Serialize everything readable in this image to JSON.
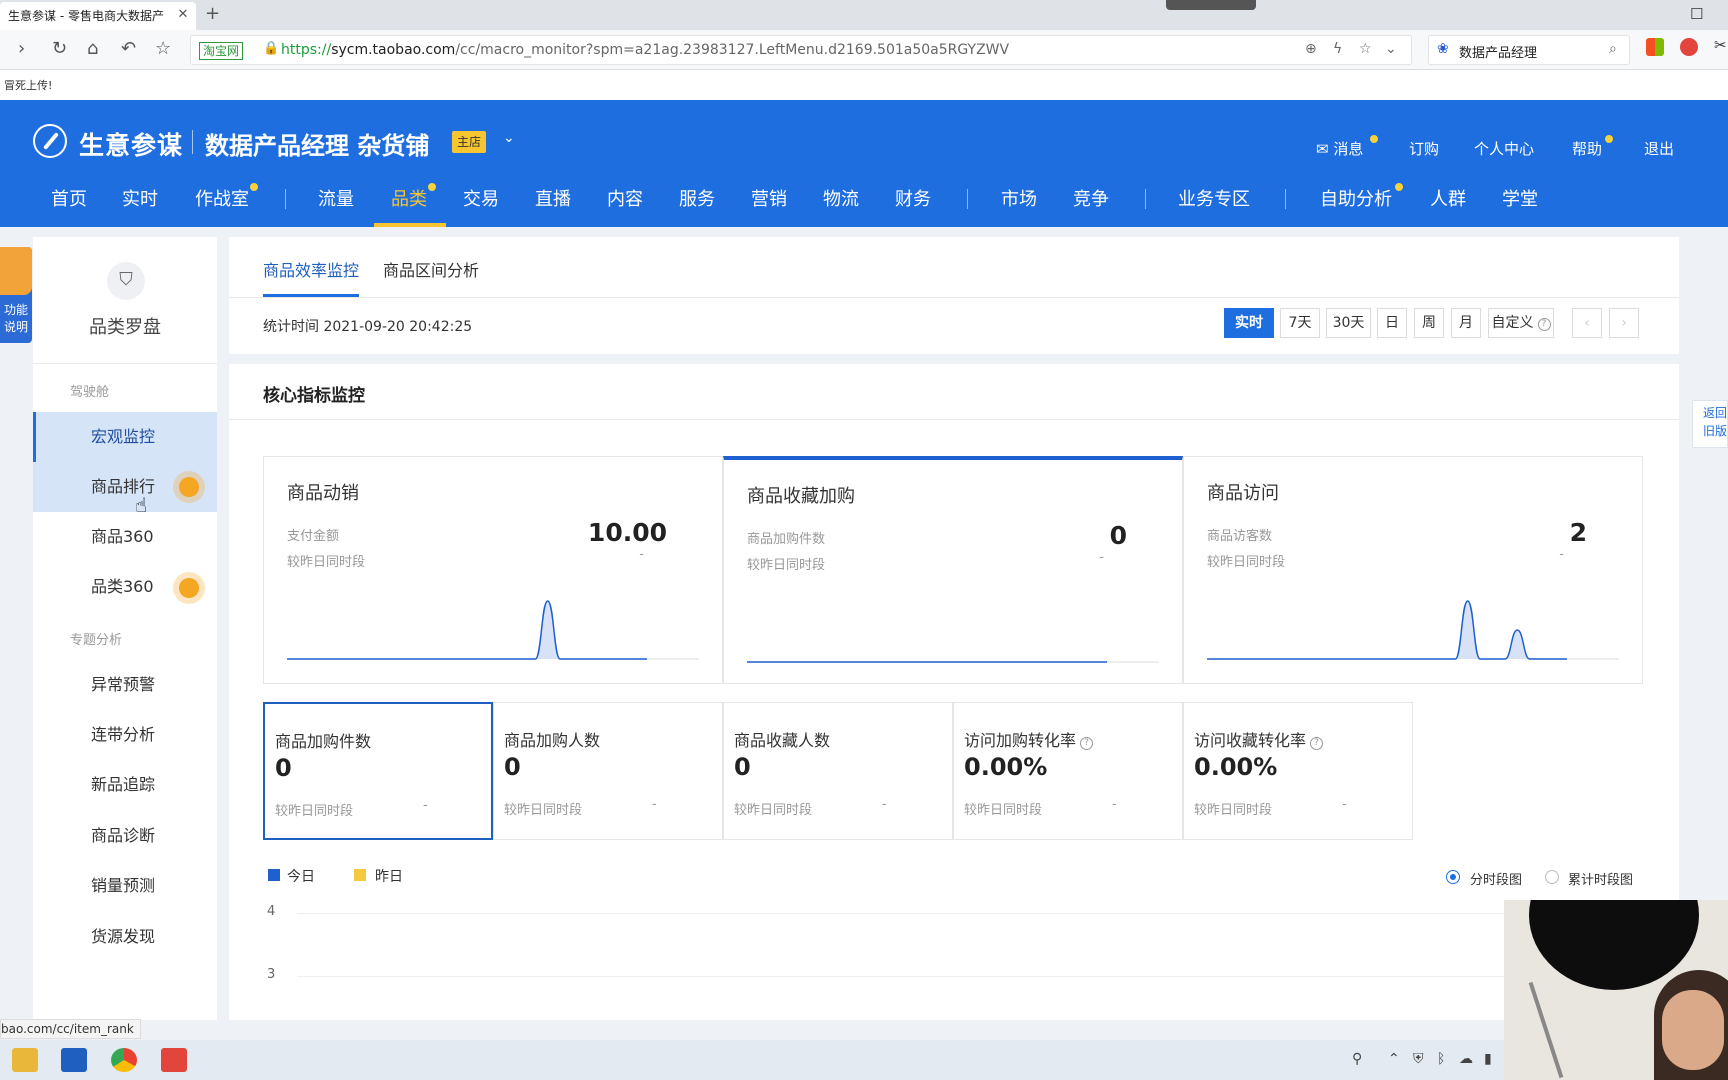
{
  "browser": {
    "tab_title": "生意参谋 - 零售电商大数据产",
    "tab_close": "✕",
    "new_tab": "+",
    "site_badge": "淘宝网",
    "url_https": "https://",
    "url_host": "sycm.taobao.com",
    "url_path": "/cc/macro_monitor?spm=a21ag.23983127.LeftMenu.d2169.501a50a5RGYZWV",
    "search_value": "数据产品经理",
    "bookmark": "冒死上传!",
    "status_url": "bao.com/cc/item_rank",
    "icons": [
      "back-icon",
      "forward-icon",
      "refresh-icon",
      "home-icon",
      "undo-icon",
      "star-icon",
      "zoom-icon",
      "lightning-icon",
      "bookmark-star-icon",
      "chevron-down-icon",
      "search-icon"
    ]
  },
  "header": {
    "logo_text": "生意参谋",
    "shop_name": "数据产品经理 杂货铺",
    "shop_badge": "主店",
    "top_links": {
      "messages": "消息",
      "subscribe": "订购",
      "personal": "个人中心",
      "help": "帮助",
      "logout": "退出"
    },
    "nav": [
      "首页",
      "实时",
      "作战室",
      "流量",
      "品类",
      "交易",
      "直播",
      "内容",
      "服务",
      "营销",
      "物流",
      "财务",
      "市场",
      "竞争",
      "业务专区",
      "自助分析",
      "人群",
      "学堂"
    ],
    "active_nav": "品类",
    "brand_color": "#1f6ee0",
    "accent_color": "#f7c530"
  },
  "helper": {
    "text_line1": "功能",
    "text_line2": "说明"
  },
  "sidebar": {
    "title": "品类罗盘",
    "section1": "驾驶舱",
    "section1_items": [
      "宏观监控",
      "商品排行",
      "商品360",
      "品类360"
    ],
    "section2": "专题分析",
    "section2_items": [
      "异常预警",
      "连带分析",
      "新品追踪",
      "商品诊断",
      "销量预测",
      "货源发现"
    ],
    "active_item": "宏观监控"
  },
  "tabs": {
    "items": [
      "商品效率监控",
      "商品区间分析"
    ],
    "active": "商品效率监控",
    "stat_time_label": "统计时间 2021-09-20 20:42:25",
    "periods": [
      "实时",
      "7天",
      "30天",
      "日",
      "周",
      "月",
      "自定义"
    ],
    "active_period": "实时",
    "prev": "‹",
    "next": "›"
  },
  "core": {
    "title": "核心指标监控",
    "cards": [
      {
        "title": "商品动销",
        "metric_label": "支付金额",
        "value": "10.00",
        "cmp_label": "较昨日同时段",
        "cmp_value": "-",
        "peaks": [
          0,
          0,
          0,
          0,
          0,
          0,
          0,
          0,
          0,
          0,
          0,
          0,
          0,
          0,
          0,
          0,
          0,
          0,
          0,
          0,
          0,
          10,
          0,
          0,
          0,
          0,
          0,
          0,
          0,
          0
        ],
        "active": false
      },
      {
        "title": "商品收藏加购",
        "metric_label": "商品加购件数",
        "value": "0",
        "cmp_label": "较昨日同时段",
        "cmp_value": "-",
        "peaks": [
          0,
          0,
          0,
          0,
          0,
          0,
          0,
          0,
          0,
          0,
          0,
          0,
          0,
          0,
          0,
          0,
          0,
          0,
          0,
          0,
          0,
          0,
          0,
          0,
          0,
          0,
          0,
          0,
          0,
          0
        ],
        "active": true
      },
      {
        "title": "商品访问",
        "metric_label": "商品访客数",
        "value": "2",
        "cmp_label": "较昨日同时段",
        "cmp_value": "-",
        "peaks": [
          0,
          0,
          0,
          0,
          0,
          0,
          0,
          0,
          0,
          0,
          0,
          0,
          0,
          0,
          0,
          0,
          0,
          0,
          0,
          0,
          0,
          2,
          0,
          0,
          0,
          1,
          0,
          0,
          0,
          0
        ],
        "active": false
      }
    ],
    "metrics": [
      {
        "label": "商品加购件数",
        "value": "0",
        "cmp_label": "较昨日同时段",
        "cmp_value": "-",
        "help": false
      },
      {
        "label": "商品加购人数",
        "value": "0",
        "cmp_label": "较昨日同时段",
        "cmp_value": "-",
        "help": false
      },
      {
        "label": "商品收藏人数",
        "value": "0",
        "cmp_label": "较昨日同时段",
        "cmp_value": "-",
        "help": false
      },
      {
        "label": "访问加购转化率",
        "value": "0.00%",
        "cmp_label": "较昨日同时段",
        "cmp_value": "-",
        "help": true
      },
      {
        "label": "访问收藏转化率",
        "value": "0.00%",
        "cmp_label": "较昨日同时段",
        "cmp_value": "-",
        "help": true
      }
    ],
    "legend": {
      "today": "今日",
      "yesterday": "昨日",
      "today_color": "#1f5fd0",
      "yesterday_color": "#f5c842"
    },
    "view_modes": [
      "分时段图",
      "累计时段图"
    ],
    "active_view": "分时段图",
    "y_ticks": [
      "4",
      "3"
    ]
  },
  "back_old": {
    "line1": "返回",
    "line2": "旧版"
  }
}
